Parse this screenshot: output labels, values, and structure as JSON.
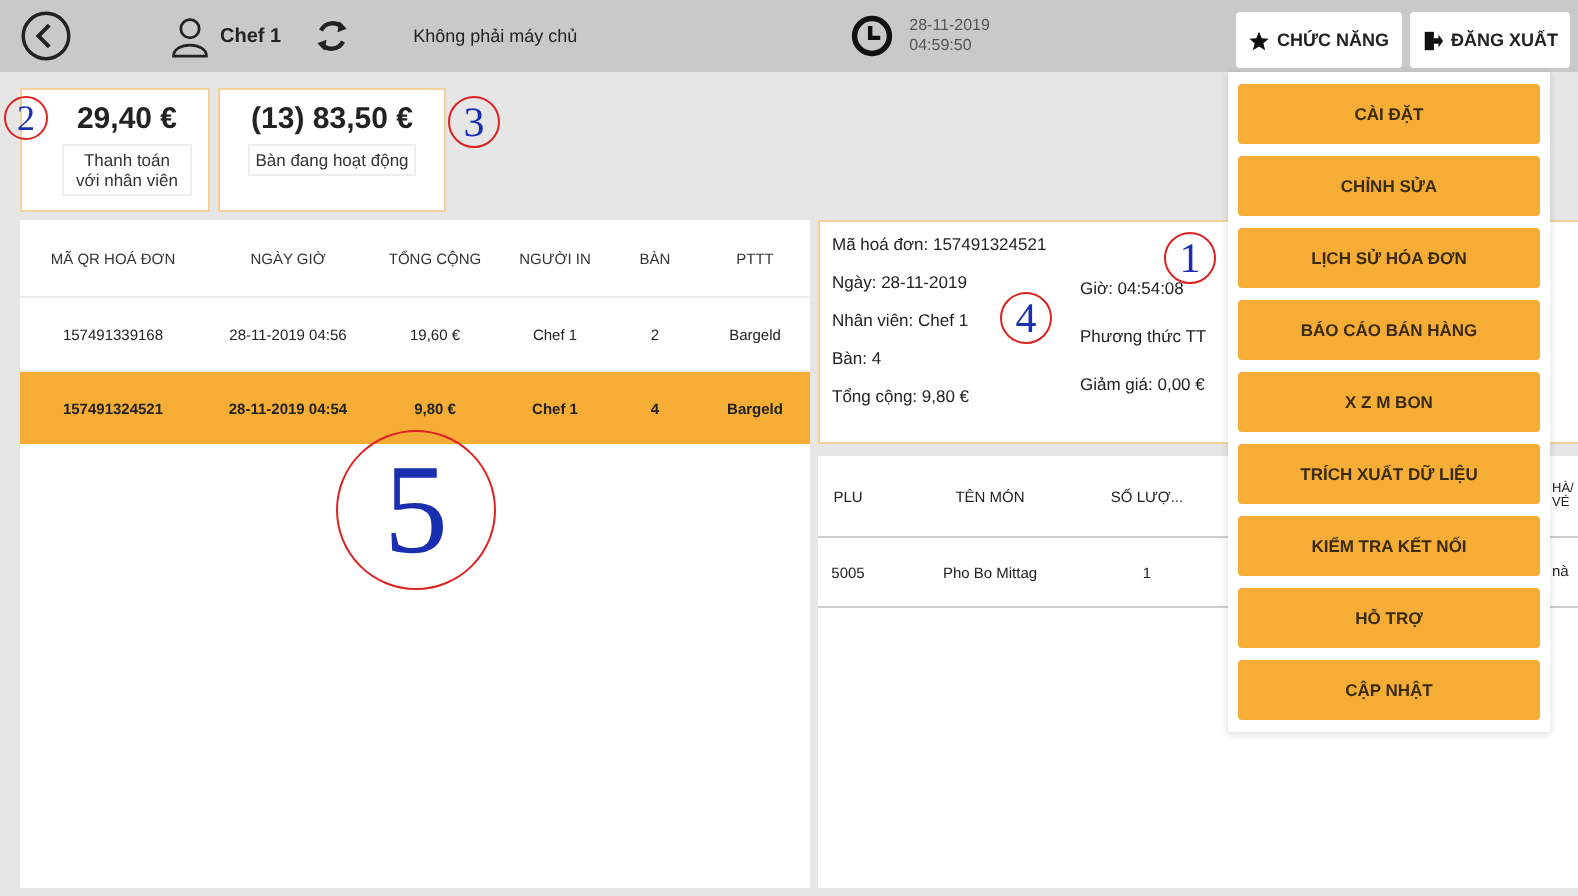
{
  "top_bar": {
    "user": "Chef 1",
    "server_status": "Không phải máy chủ",
    "date": "28-11-2019",
    "time": "04:59:50",
    "function_button": "CHỨC NĂNG",
    "logout_button": "ĐĂNG XUẤT"
  },
  "summary_cards": [
    {
      "amount": "29,40 €",
      "label": "Thanh toán với nhân viên"
    },
    {
      "amount": "(13) 83,50 €",
      "label": "Bàn đang hoạt động"
    }
  ],
  "invoice_table": {
    "columns": [
      "MÃ QR HOÁ ĐƠN",
      "NGÀY GIỜ",
      "TỔNG CỘNG",
      "NGƯỜI IN",
      "BÀN",
      "PTTT"
    ],
    "rows": [
      {
        "cells": [
          "157491339168",
          "28-11-2019 04:56",
          "19,60 €",
          "Chef 1",
          "2",
          "Bargeld"
        ],
        "selected": false
      },
      {
        "cells": [
          "157491324521",
          "28-11-2019 04:54",
          "9,80 €",
          "Chef 1",
          "4",
          "Bargeld"
        ],
        "selected": true
      }
    ]
  },
  "invoice_detail": {
    "left": [
      "Mã hoá đơn: 157491324521",
      "Ngày: 28-11-2019",
      "Nhân viên: Chef 1",
      "Bàn: 4",
      "Tổng cộng: 9,80 €"
    ],
    "right": [
      "Giờ: 04:54:08",
      "Phương thức TT",
      "Giảm giá: 0,00 €"
    ]
  },
  "items_table": {
    "columns": [
      "PLU",
      "TÊN MÓN",
      "SỐ LƯỢ...",
      "HÀ/ VÉ"
    ],
    "rows": [
      {
        "cells": [
          "5005",
          "Pho Bo Mittag",
          "1",
          "nà"
        ]
      }
    ]
  },
  "function_menu": [
    "CÀI ĐẶT",
    "CHỈNH SỬA",
    "LỊCH SỬ HÓA ĐƠN",
    "BÁO CÁO BÁN HÀNG",
    "X Z M BON",
    "TRÍCH XUẤT DỮ LIỆU",
    "KIỂM TRA KẾT NỐI",
    "HỖ TRỢ",
    "CẬP NHẬT"
  ],
  "callouts": [
    "1",
    "2",
    "3",
    "4",
    "5"
  ]
}
